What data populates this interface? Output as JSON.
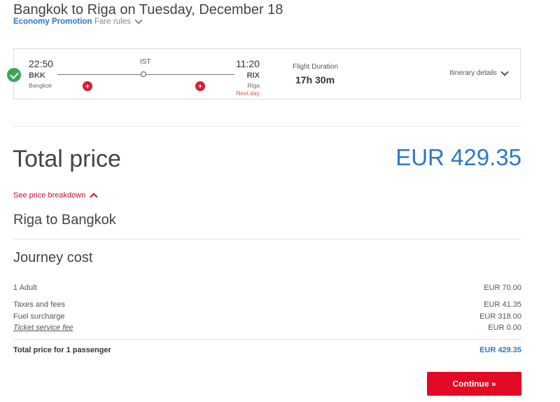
{
  "header": {
    "title": "Bangkok to Riga on Tuesday, December 18",
    "fare_class": "Economy Promotion",
    "fare_rules": "Fare rules"
  },
  "flight": {
    "dep_time": "22:50",
    "dep_code": "BKK",
    "dep_city": "Bangkok",
    "stop": "IST",
    "arr_time": "11:20",
    "arr_code": "RIX",
    "arr_city": "Riga",
    "next_day": "Next day",
    "duration_label": "Flight Duration",
    "duration_value": "17h 30m",
    "itinerary_details": "Itinerary details",
    "airline_icon": "turkish-airlines-logo",
    "accent_color": "#d3202e"
  },
  "total": {
    "label": "Total price",
    "value": "EUR 429.35",
    "color": "#2d78c8"
  },
  "breakdown": {
    "toggle": "See price breakdown",
    "section_title": "Riga to Bangkok",
    "journey_title": "Journey cost",
    "rows": [
      {
        "label": "1 Adult",
        "value": "EUR 70.00"
      },
      {
        "label": "Taxes and fees",
        "value": "EUR 41.35"
      },
      {
        "label": "Fuel surcharge",
        "value": "EUR 318.00"
      },
      {
        "label": "Ticket service fee",
        "value": "EUR 0.00"
      }
    ],
    "total_label": "Total price for 1 passenger",
    "total_value": "EUR 429.35"
  },
  "actions": {
    "continue": "Continue »",
    "continue_color": "#e20a24"
  }
}
